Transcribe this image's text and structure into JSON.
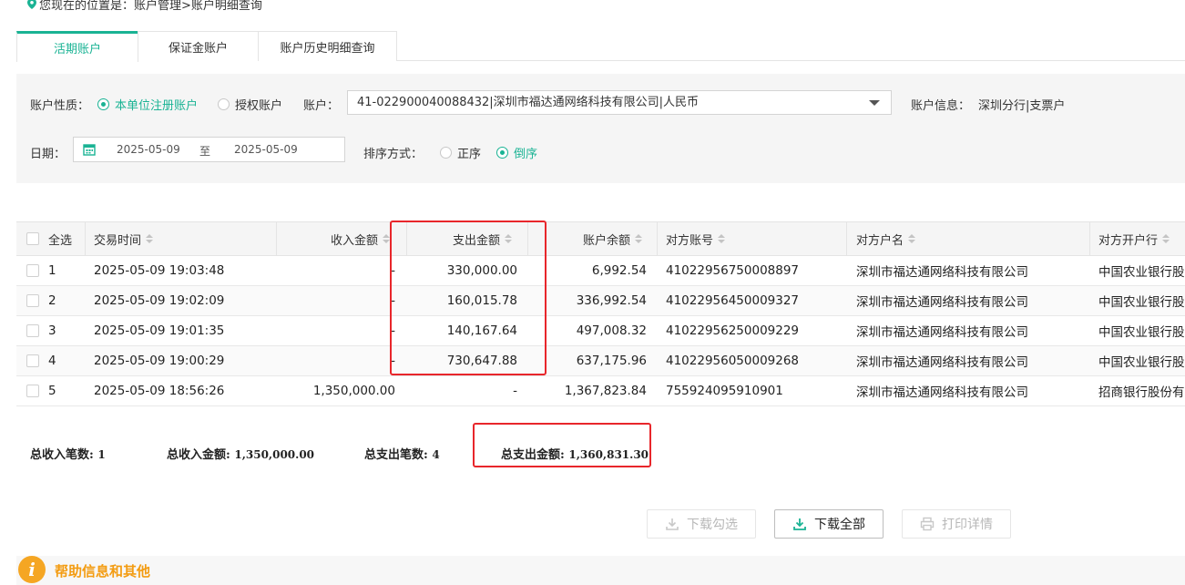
{
  "breadcrumb": "您现在的位置是：账户管理>账户明细查询",
  "tabs": [
    "活期账户",
    "保证金账户",
    "账户历史明细查询"
  ],
  "filter": {
    "account_type_label": "账户性质：",
    "account_type_options": [
      "本单位注册账户",
      "授权账户"
    ],
    "account_label": "账户：",
    "account_value": "41-022900040088432|深圳市福达通网络科技有限公司|人民币",
    "account_info_label": "账户信息：",
    "account_info_value": "深圳分行|支票户",
    "date_label": "日期：",
    "date_from": "2025-05-09",
    "date_sep": "至",
    "date_to": "2025-05-09",
    "sort_label": "排序方式：",
    "sort_options": [
      "正序",
      "倒序"
    ]
  },
  "table": {
    "select_all": "全选",
    "headers": [
      "交易时间",
      "收入金额",
      "支出金额",
      "账户余额",
      "对方账号",
      "对方户名",
      "对方开户行"
    ],
    "rows": [
      {
        "idx": "1",
        "time": "2025-05-09 19:03:48",
        "income": "-",
        "expense": "330,000.00",
        "balance": "6,992.54",
        "acct": "41022956750008897",
        "name": "深圳市福达通网络科技有限公司",
        "bank": "中国农业银行股"
      },
      {
        "idx": "2",
        "time": "2025-05-09 19:02:09",
        "income": "-",
        "expense": "160,015.78",
        "balance": "336,992.54",
        "acct": "41022956450009327",
        "name": "深圳市福达通网络科技有限公司",
        "bank": "中国农业银行股"
      },
      {
        "idx": "3",
        "time": "2025-05-09 19:01:35",
        "income": "-",
        "expense": "140,167.64",
        "balance": "497,008.32",
        "acct": "41022956250009229",
        "name": "深圳市福达通网络科技有限公司",
        "bank": "中国农业银行股"
      },
      {
        "idx": "4",
        "time": "2025-05-09 19:00:29",
        "income": "-",
        "expense": "730,647.88",
        "balance": "637,175.96",
        "acct": "41022956050009268",
        "name": "深圳市福达通网络科技有限公司",
        "bank": "中国农业银行股"
      },
      {
        "idx": "5",
        "time": "2025-05-09 18:56:26",
        "income": "1,350,000.00",
        "expense": "-",
        "balance": "1,367,823.84",
        "acct": "755924095910901",
        "name": "深圳市福达通网络科技有限公司",
        "bank": "招商银行股份有"
      }
    ]
  },
  "totals": {
    "income_count_label": "总收入笔数:",
    "income_count": "1",
    "income_amount_label": "总收入金额:",
    "income_amount": "1,350,000.00",
    "expense_count_label": "总支出笔数:",
    "expense_count": "4",
    "expense_amount_label": "总支出金额:",
    "expense_amount": "1,360,831.30"
  },
  "buttons": {
    "download_selected": "下载勾选",
    "download_all": "下载全部",
    "print_detail": "打印详情"
  },
  "help": {
    "title": "帮助信息和其他"
  },
  "colors": {
    "accent": "#1ab394",
    "highlight_box": "#e8262b",
    "help_orange": "#f5a623"
  }
}
